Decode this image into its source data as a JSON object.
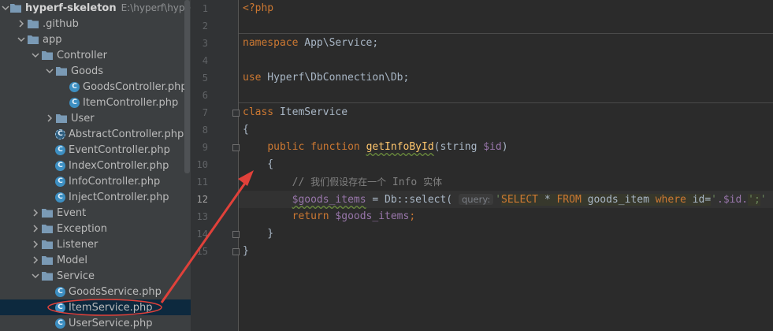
{
  "project_tree": {
    "root": {
      "name": "hyperf-skeleton",
      "path": "E:\\hyperf\\hyperf-s"
    },
    "items": [
      {
        "label": ".github",
        "type": "folder",
        "depth": 1,
        "expanded": false
      },
      {
        "label": "app",
        "type": "folder",
        "depth": 1,
        "expanded": true
      },
      {
        "label": "Controller",
        "type": "folder",
        "depth": 2,
        "expanded": true
      },
      {
        "label": "Goods",
        "type": "folder",
        "depth": 3,
        "expanded": true
      },
      {
        "label": "GoodsController.php",
        "type": "class",
        "depth": 4
      },
      {
        "label": "ItemController.php",
        "type": "class",
        "depth": 4
      },
      {
        "label": "User",
        "type": "folder",
        "depth": 3,
        "expanded": false
      },
      {
        "label": "AbstractController.php",
        "type": "abstract",
        "depth": 3
      },
      {
        "label": "EventController.php",
        "type": "class",
        "depth": 3
      },
      {
        "label": "IndexController.php",
        "type": "class",
        "depth": 3
      },
      {
        "label": "InfoController.php",
        "type": "class",
        "depth": 3
      },
      {
        "label": "InjectController.php",
        "type": "class",
        "depth": 3
      },
      {
        "label": "Event",
        "type": "folder",
        "depth": 2,
        "expanded": false
      },
      {
        "label": "Exception",
        "type": "folder",
        "depth": 2,
        "expanded": false
      },
      {
        "label": "Listener",
        "type": "folder",
        "depth": 2,
        "expanded": false
      },
      {
        "label": "Model",
        "type": "folder",
        "depth": 2,
        "expanded": false
      },
      {
        "label": "Service",
        "type": "folder",
        "depth": 2,
        "expanded": true
      },
      {
        "label": "GoodsService.php",
        "type": "class",
        "depth": 3
      },
      {
        "label": "ItemService.php",
        "type": "class",
        "depth": 3,
        "selected": true
      },
      {
        "label": "UserService.php",
        "type": "class",
        "depth": 3
      }
    ]
  },
  "editor": {
    "line_numbers": [
      "1",
      "2",
      "3",
      "4",
      "5",
      "6",
      "7",
      "8",
      "9",
      "10",
      "11",
      "12",
      "13",
      "14",
      "15"
    ],
    "current_line": 12,
    "code": {
      "l1_open_tag": "<?php",
      "l3_namespace_kw": "namespace",
      "l3_namespace_name": " App\\Service;",
      "l5_use_kw": "use",
      "l5_use_name": " Hyperf\\DbConnection\\Db;",
      "l7_class_kw": "class",
      "l7_class_name": " ItemService",
      "l8_brace": "{",
      "l9_indent": "    ",
      "l9_public": "public",
      "l9_function": " function ",
      "l9_fn_name": "getInfoById",
      "l9_paren": "(string ",
      "l9_param": "$id",
      "l9_close": ")",
      "l10_brace": "    {",
      "l11_comment_prefix": "        // ",
      "l11_comment_cn1": "我们假设存在一个",
      "l11_comment_info": " Info ",
      "l11_comment_cn2": "实体",
      "l12_indent": "        ",
      "l12_var": "$goods_items",
      "l12_assign": " = Db::select( ",
      "l12_hint": "query:",
      "l12_q1": "'",
      "l12_select": "SELECT",
      "l12_star": " * ",
      "l12_from": "FROM",
      "l12_table": " goods_item ",
      "l12_where": "where",
      "l12_cond": " id=",
      "l12_q2": "'",
      "l12_concat": ".$id.",
      "l12_q3": "';",
      "l12_q4": "'",
      "l13_indent": "        ",
      "l13_return": "return",
      "l13_var": " $goods_items",
      "l13_semi": ";",
      "l14_brace": "    }",
      "l15_brace": "}"
    }
  },
  "annotation": {
    "arrow_color": "#e0413a",
    "ellipse_color": "#e0413a"
  }
}
